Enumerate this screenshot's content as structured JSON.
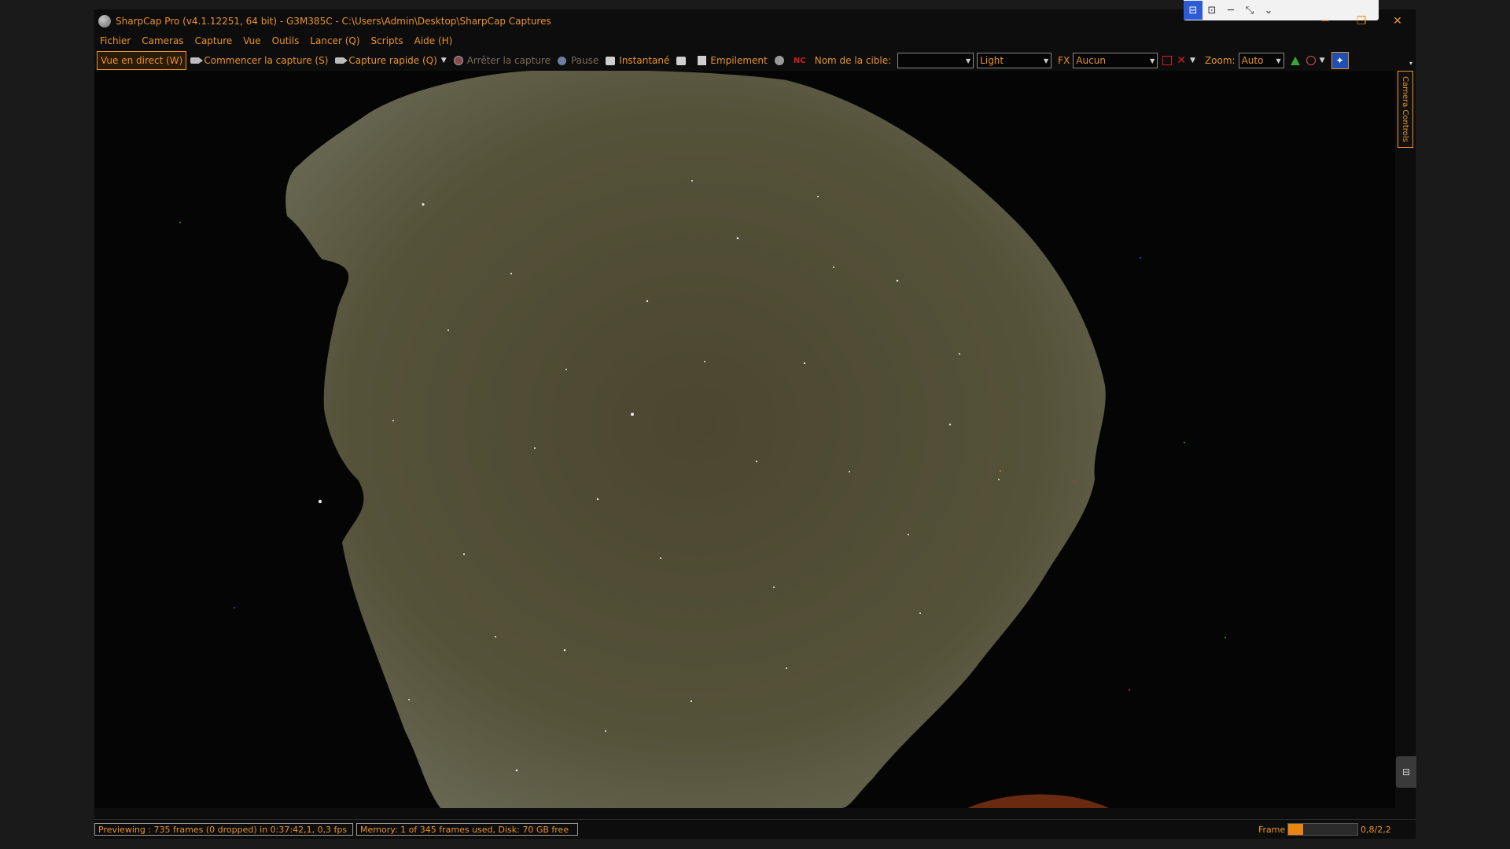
{
  "window": {
    "title": "SharpCap Pro (v4.1.12251, 64 bit) - G3M385C - C:\\Users\\Admin\\Desktop\\SharpCap Captures",
    "controls": {
      "minimize": "─",
      "restore": "❐",
      "close": "✕"
    }
  },
  "remote_bar": {
    "icons": [
      "remote-icon",
      "monitor-icon",
      "minimize-icon",
      "shrink-icon",
      "chevron-down-icon"
    ]
  },
  "menu": [
    "Fichier",
    "Cameras",
    "Capture",
    "Vue",
    "Outils",
    "Lancer (Q)",
    "Scripts",
    "Aide (H)"
  ],
  "toolbar": {
    "live_view": "Vue en direct (W)",
    "start_capture": "Commencer la capture (S)",
    "quick_capture": "Capture rapide (Q)",
    "stop_capture": "Arrêter la capture",
    "pause": "Pause",
    "snapshot": "Instantané",
    "stacking": "Empilement",
    "target_label": "Nom de la cible:",
    "target_value": "",
    "frame_type": "Light",
    "fx_label": "FX",
    "fx_value": "Aucun",
    "zoom_label": "Zoom:",
    "zoom_value": "Auto"
  },
  "side_panel": {
    "tab_label": "Camera Controls"
  },
  "status": {
    "preview": "Previewing : 735 frames (0 dropped) in 0:37:42,1, 0,3 fps",
    "memory": "Memory: 1 of 345 frames used, Disk: 70 GB free",
    "frame_label": "Frame :",
    "frame_progress": 0.22,
    "frame_rate": "0,8/2,2"
  },
  "colors": {
    "accent": "#e8932a",
    "background": "#0d0d0d",
    "sky": "#4a4a30"
  }
}
